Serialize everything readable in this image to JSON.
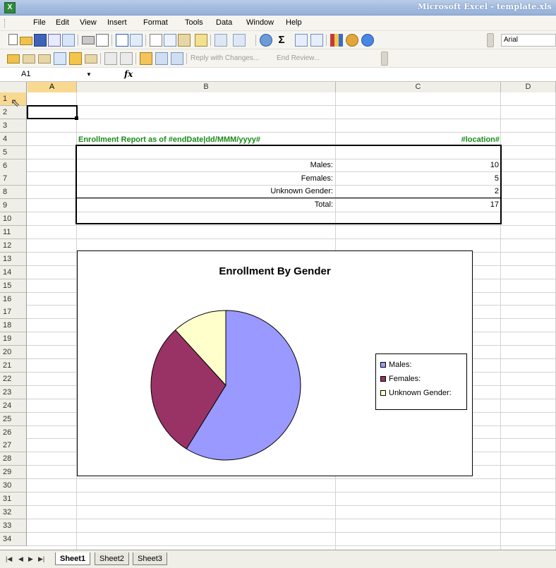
{
  "window": {
    "title": "Microsoft Excel - template.xls"
  },
  "menu": [
    "File",
    "Edit",
    "View",
    "Insert",
    "Format",
    "Tools",
    "Data",
    "Window",
    "Help"
  ],
  "toolbar": {
    "font_name": "Arial",
    "reply_with_changes": "Reply with Changes...",
    "end_review": "End Review..."
  },
  "formula_bar": {
    "name_box": "A1",
    "fx_label": "fx",
    "formula": ""
  },
  "columns": [
    "A",
    "B",
    "C",
    "D"
  ],
  "rows": [
    "1",
    "2",
    "3",
    "4",
    "5",
    "6",
    "7",
    "8",
    "9",
    "10",
    "11",
    "12",
    "13",
    "14",
    "15",
    "16",
    "17",
    "18",
    "19",
    "20",
    "21",
    "22",
    "23",
    "24",
    "25",
    "26",
    "27",
    "28",
    "29",
    "30",
    "31",
    "32",
    "33",
    "34"
  ],
  "report": {
    "title": "Enrollment Report as of #endDate|dd/MMM/yyyy#",
    "location": "#location#",
    "rows": [
      {
        "label": "Males:",
        "value": "10"
      },
      {
        "label": "Females:",
        "value": "5"
      },
      {
        "label": "Unknown Gender:",
        "value": "2"
      },
      {
        "label": "Total:",
        "value": "17"
      }
    ]
  },
  "chart_data": {
    "type": "pie",
    "title": "Enrollment By Gender",
    "categories": [
      "Males:",
      "Females:",
      "Unknown Gender:"
    ],
    "values": [
      10,
      5,
      2
    ],
    "colors": [
      "#9999ff",
      "#993366",
      "#ffffcc"
    ],
    "legend": "right"
  },
  "sheets": [
    {
      "name": "Sheet1",
      "active": true
    },
    {
      "name": "Sheet2",
      "active": false
    },
    {
      "name": "Sheet3",
      "active": false
    }
  ]
}
